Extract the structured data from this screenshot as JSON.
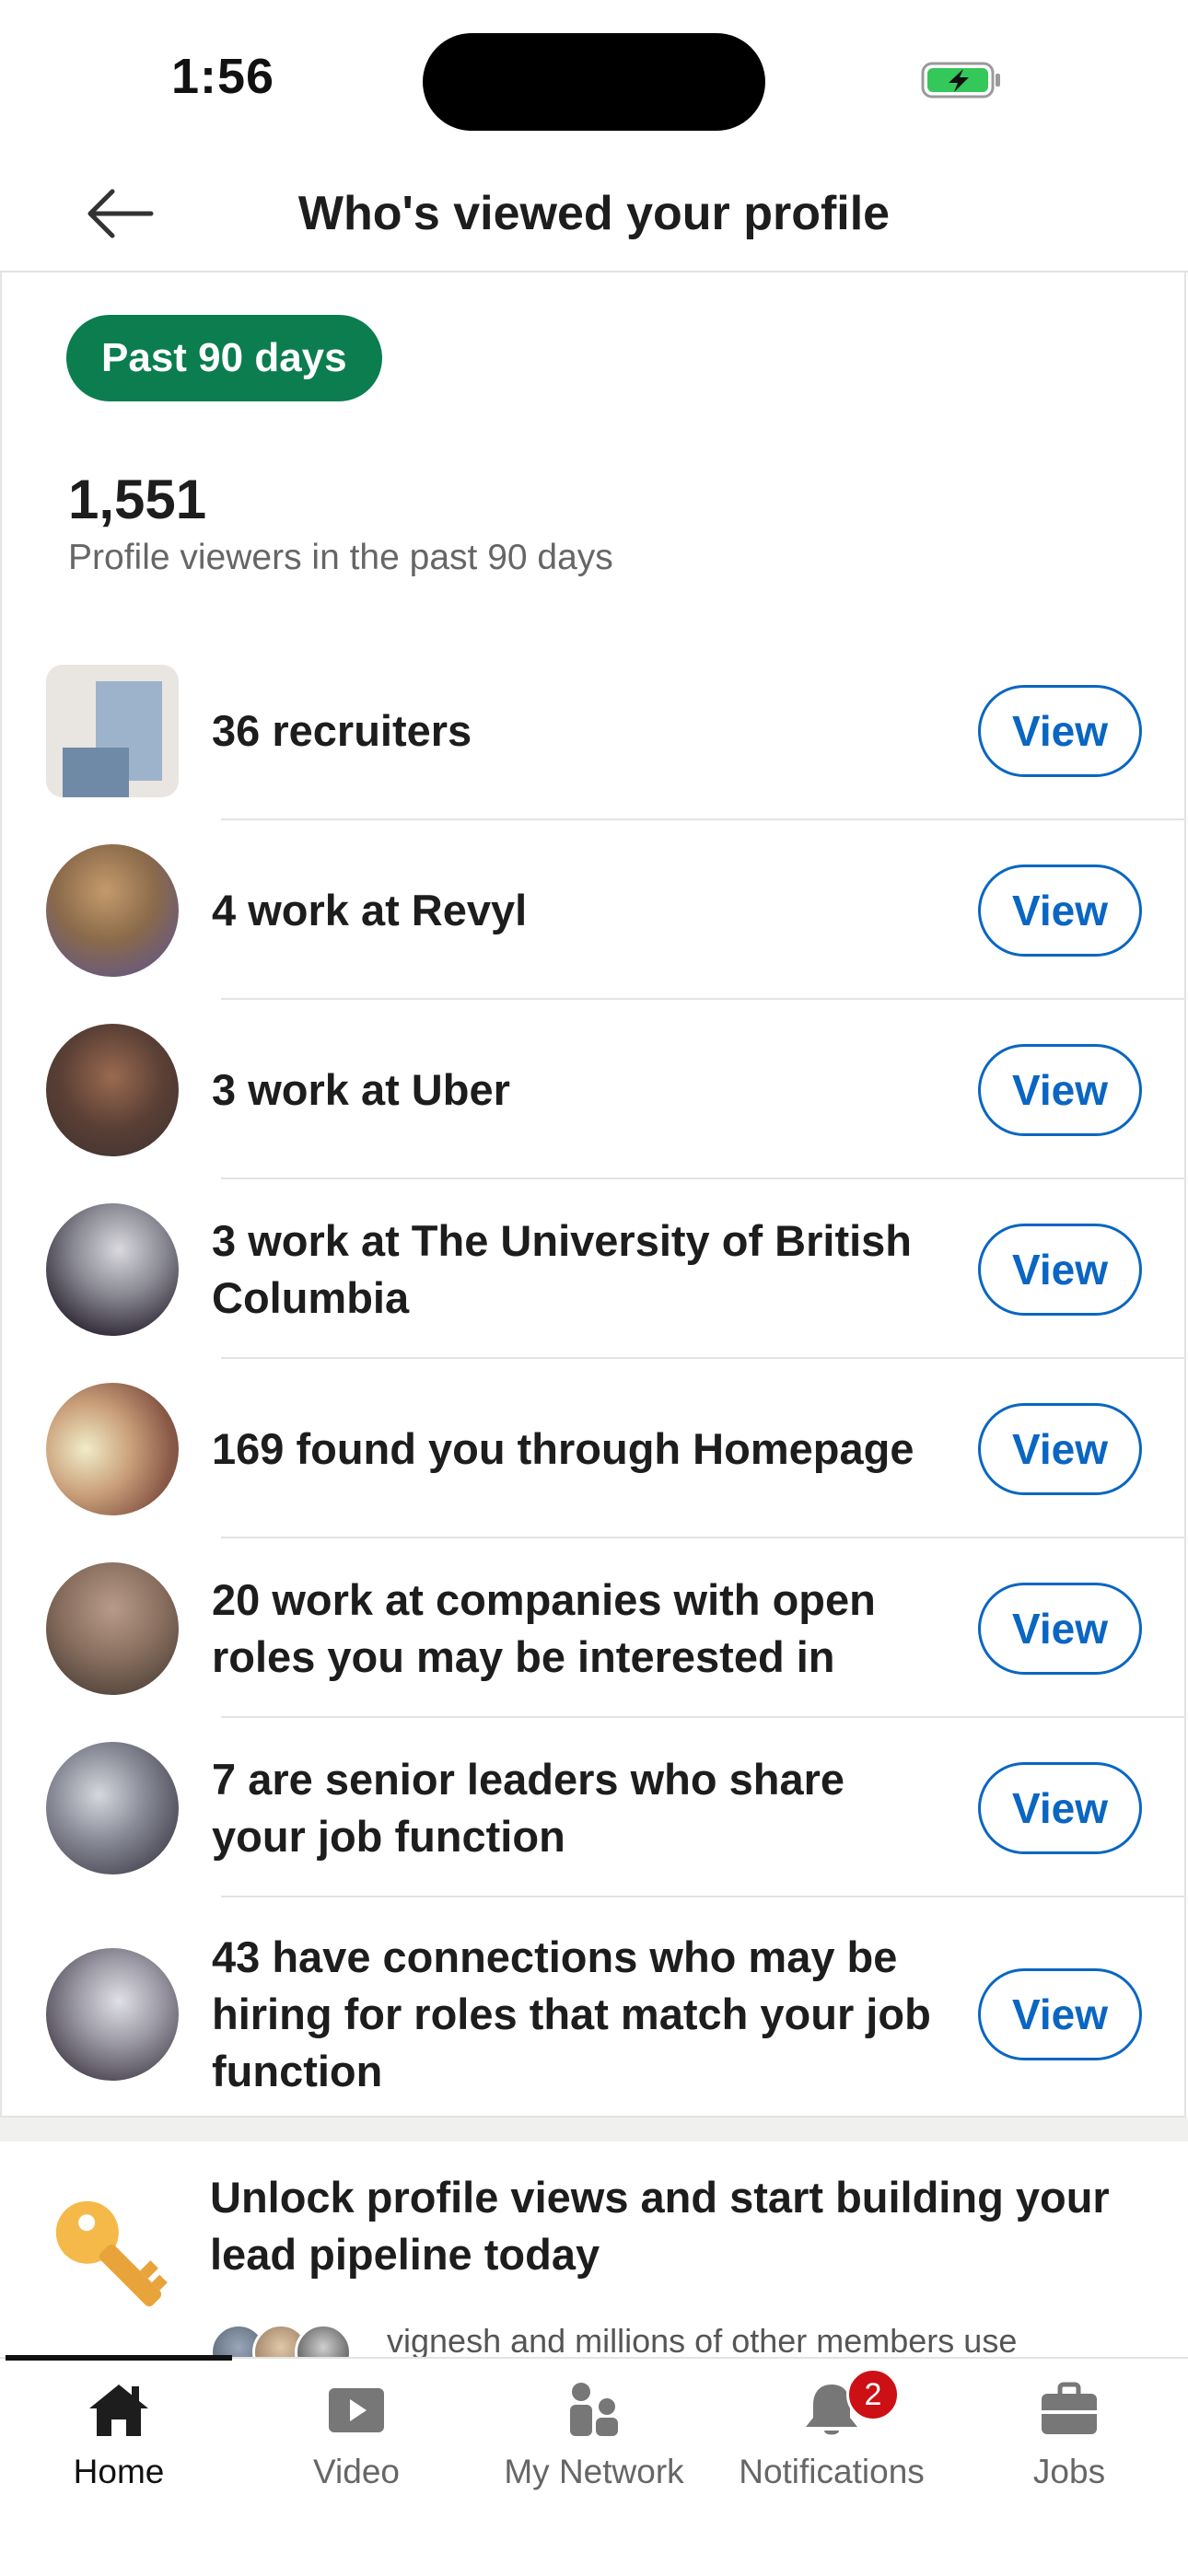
{
  "status_bar": {
    "time": "1:56"
  },
  "header": {
    "title": "Who's viewed your profile"
  },
  "filter": {
    "label": "Past 90 days"
  },
  "summary": {
    "count": "1,551",
    "label": "Profile viewers in the past 90 days"
  },
  "rows": [
    {
      "text": "36 recruiters",
      "button": "View"
    },
    {
      "text": "4 work at Revyl",
      "button": "View"
    },
    {
      "text": "3 work at Uber",
      "button": "View"
    },
    {
      "text": "3 work at The University of British Columbia",
      "button": "View"
    },
    {
      "text": "169 found you through Homepage",
      "button": "View"
    },
    {
      "text": "20 work at companies with open roles you may be interested in",
      "button": "View"
    },
    {
      "text": "7 are senior leaders who share your job function",
      "button": "View"
    },
    {
      "text": "43 have connections who may be hiring for roles that match your job function",
      "button": "View"
    }
  ],
  "promo": {
    "title": "Unlock profile views and start building your lead pipeline today",
    "subtitle": "vignesh and millions of other members use"
  },
  "tabs": [
    {
      "label": "Home",
      "icon": "home-icon",
      "active": true
    },
    {
      "label": "Video",
      "icon": "video-icon"
    },
    {
      "label": "My Network",
      "icon": "network-icon"
    },
    {
      "label": "Notifications",
      "icon": "bell-icon",
      "badge": "2"
    },
    {
      "label": "Jobs",
      "icon": "briefcase-icon"
    }
  ],
  "colors": {
    "accent": "#0a66c2",
    "pill": "#0b7d4f",
    "badge": "#cc1016",
    "battery": "#34c759",
    "key": "#f5b94a"
  }
}
